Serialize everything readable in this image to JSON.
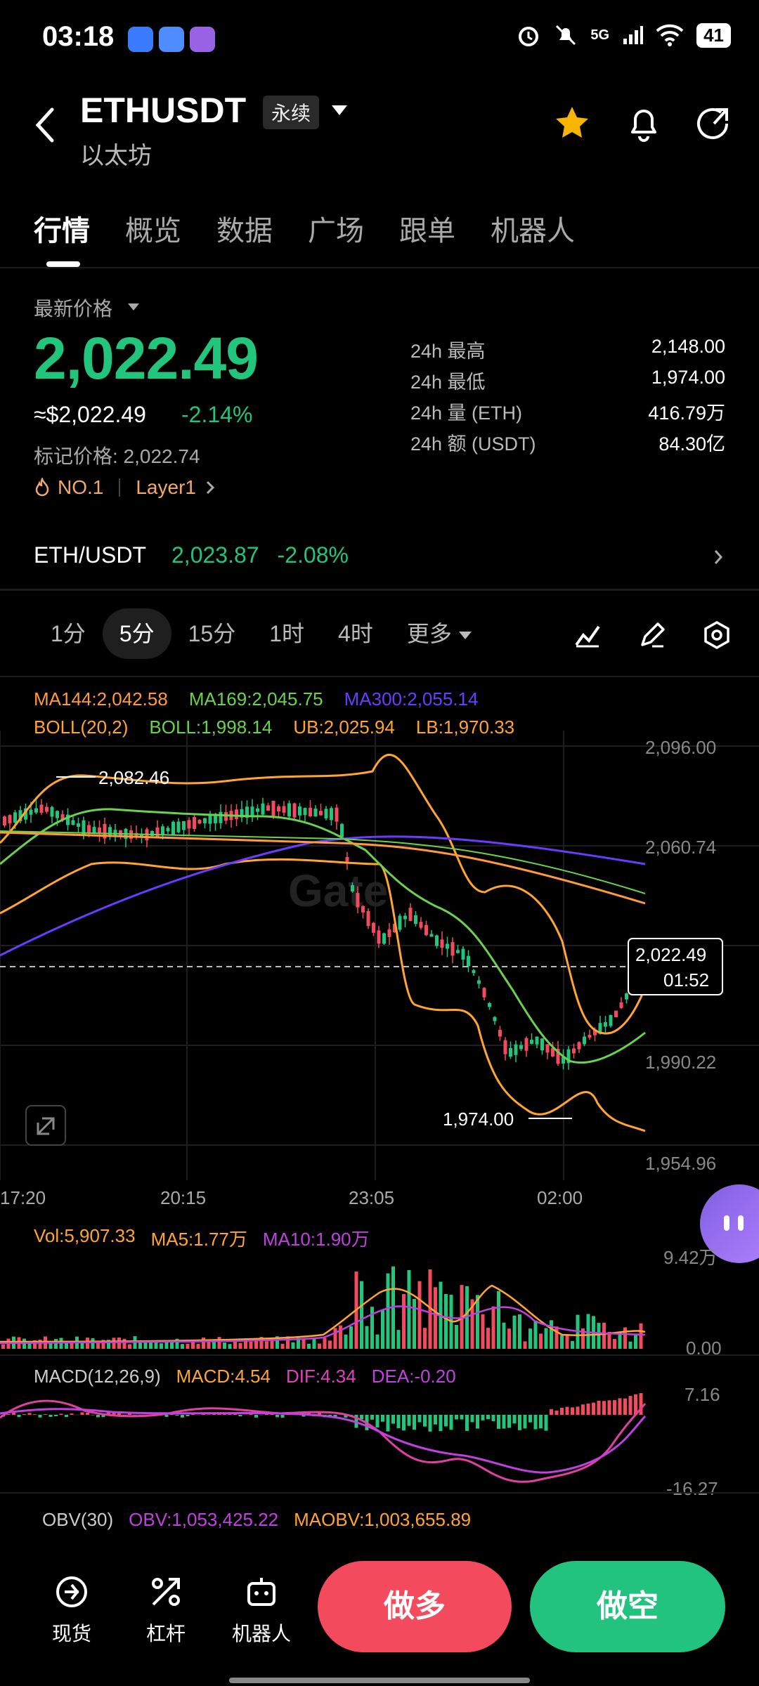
{
  "status_bar": {
    "time": "03:18",
    "battery": "41",
    "network": "5G"
  },
  "header": {
    "symbol": "ETHUSDT",
    "contract_type": "永续",
    "name": "以太坊",
    "accent": "#f7b500"
  },
  "tabs": [
    "行情",
    "概览",
    "数据",
    "广场",
    "跟单",
    "机器人"
  ],
  "price": {
    "latest_label": "最新价格",
    "last": "2,022.49",
    "usd": "≈$2,022.49",
    "change": "-2.14%",
    "mark_label": "标记价格: 2,022.74",
    "rank": "NO.1",
    "category": "Layer1",
    "stats": [
      {
        "k": "24h  最高",
        "v": "2,148.00"
      },
      {
        "k": "24h  最低",
        "v": "1,974.00"
      },
      {
        "k": "24h  量 (ETH)",
        "v": "416.79万"
      },
      {
        "k": "24h  额 (USDT)",
        "v": "84.30亿"
      }
    ]
  },
  "spot": {
    "pair": "ETH/USDT",
    "price": "2,023.87",
    "change": "-2.08%"
  },
  "timeframes": {
    "items": [
      "1分",
      "5分",
      "15分",
      "1时",
      "4时"
    ],
    "more": "更多",
    "active": "5分"
  },
  "indicators": {
    "ma144": "MA144:2,042.58",
    "ma169": "MA169:2,045.75",
    "ma300": "MA300:2,055.14",
    "boll": "BOLL(20,2)",
    "boll_mid": "BOLL:1,998.14",
    "boll_ub": "UB:2,025.94",
    "boll_lb": "LB:1,970.33"
  },
  "chart": {
    "y_labels": [
      "2,096.00",
      "2,060.74",
      "1,990.22",
      "1,954.96"
    ],
    "x_labels": [
      "17:20",
      "20:15",
      "23:05",
      "02:00"
    ],
    "high_marker": "2,082.46",
    "low_marker": "1,974.00",
    "current_price": "2,022.49",
    "countdown": "01:52",
    "colors": {
      "up": "#f34b5d",
      "down": "#21c57c",
      "ma144": "#ff9a3c",
      "ma169": "#6ad24c",
      "ma300": "#6a3cff",
      "boll": "#ffa530"
    }
  },
  "volume": {
    "vol": "Vol:5,907.33",
    "ma5": "MA5:1.77万",
    "ma10": "MA10:1.90万",
    "y_top": "9.42万",
    "y_bottom": "0.00"
  },
  "macd": {
    "label": "MACD(12,26,9)",
    "macd": "MACD:4.54",
    "dif": "DIF:4.34",
    "dea": "DEA:-0.20",
    "y_top": "7.16",
    "y_bottom": "-16.27"
  },
  "obv": {
    "label": "OBV(30)",
    "obv": "OBV:1,053,425.22",
    "maobv": "MAOBV:1,003,655.89"
  },
  "bottom_nav": {
    "items": [
      "现货",
      "杠杆",
      "机器人"
    ],
    "long": "做多",
    "short": "做空"
  }
}
